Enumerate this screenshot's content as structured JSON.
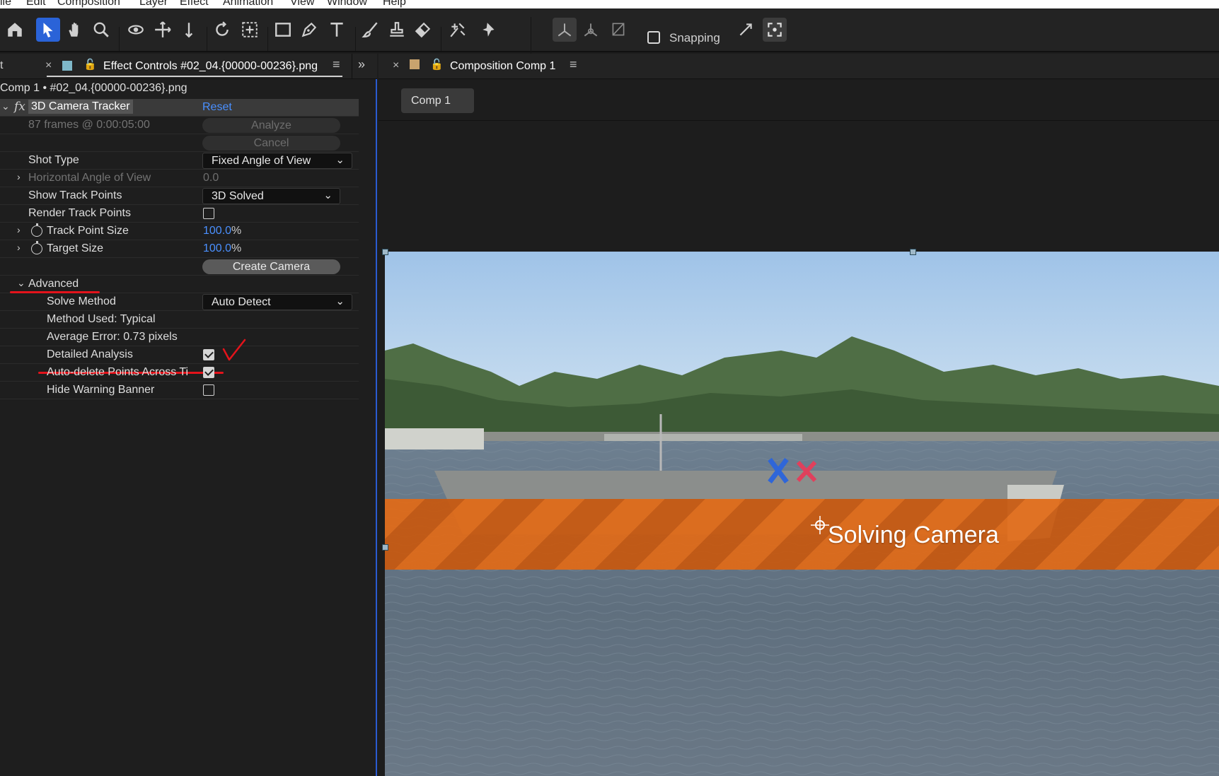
{
  "menubar": [
    "ile",
    "Edit",
    "Composition",
    "Layer",
    "Effect",
    "Animation",
    "View",
    "Window",
    "Help"
  ],
  "toolbar": {
    "tools": [
      "home-icon",
      "selection-arrow-icon",
      "hand-icon",
      "zoom-icon",
      "orbit-icon",
      "track-xy-icon",
      "track-z-icon",
      "rotate-icon",
      "pan-behind-icon",
      "rectangle-icon",
      "pen-icon",
      "type-icon",
      "brush-icon",
      "clone-stamp-icon",
      "eraser-icon",
      "roto-brush-icon",
      "puppet-pin-icon"
    ],
    "axis_tools": [
      "local-axis-icon",
      "world-axis-icon",
      "view-axis-icon"
    ],
    "snapping_label": "Snapping",
    "accent": "#2a63d8"
  },
  "effect_panel": {
    "tab_prefix": "t",
    "tab_title": "Effect Controls #02_04.{00000-00236}.png",
    "subtitle": "Comp 1 • #02_04.{00000-00236}.png",
    "effect_name": "3D Camera Tracker",
    "reset_label": "Reset",
    "frames_info": "87 frames @ 0:00:05:00",
    "analyze_label": "Analyze",
    "cancel_label": "Cancel",
    "shot_type_label": "Shot Type",
    "shot_type_value": "Fixed Angle of View",
    "haov_label": "Horizontal Angle of View",
    "haov_value": "0.0",
    "show_track_points_label": "Show Track Points",
    "show_track_points_value": "3D Solved",
    "render_track_points_label": "Render Track Points",
    "render_track_points_checked": false,
    "track_point_size_label": "Track Point Size",
    "track_point_size_value": "100.0",
    "target_size_label": "Target Size",
    "target_size_value": "100.0",
    "percent": "%",
    "create_camera_label": "Create Camera",
    "advanced_label": "Advanced",
    "solve_method_label": "Solve Method",
    "solve_method_value": "Auto Detect",
    "method_used": "Method Used: Typical",
    "average_error": "Average Error: 0.73 pixels",
    "detailed_analysis_label": "Detailed Analysis",
    "detailed_analysis_checked": true,
    "auto_delete_label": "Auto-delete Points Across Ti",
    "auto_delete_checked": true,
    "hide_warning_label": "Hide Warning Banner",
    "hide_warning_checked": false
  },
  "comp_panel": {
    "tab_title": "Composition Comp 1",
    "breadcrumb": "Comp 1",
    "banner_text": "Solving Camera",
    "banner_color": "#e26a16"
  },
  "annotations": {
    "color": "#e3131b"
  }
}
